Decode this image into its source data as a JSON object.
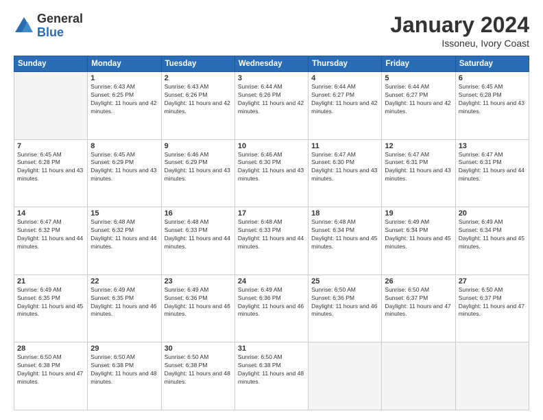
{
  "logo": {
    "general": "General",
    "blue": "Blue"
  },
  "header": {
    "month": "January 2024",
    "location": "Issoneu, Ivory Coast"
  },
  "weekdays": [
    "Sunday",
    "Monday",
    "Tuesday",
    "Wednesday",
    "Thursday",
    "Friday",
    "Saturday"
  ],
  "weeks": [
    [
      {
        "day": "",
        "sunrise": "",
        "sunset": "",
        "daylight": "",
        "empty": true
      },
      {
        "day": "1",
        "sunrise": "Sunrise: 6:43 AM",
        "sunset": "Sunset: 6:25 PM",
        "daylight": "Daylight: 11 hours and 42 minutes."
      },
      {
        "day": "2",
        "sunrise": "Sunrise: 6:43 AM",
        "sunset": "Sunset: 6:26 PM",
        "daylight": "Daylight: 11 hours and 42 minutes."
      },
      {
        "day": "3",
        "sunrise": "Sunrise: 6:44 AM",
        "sunset": "Sunset: 6:26 PM",
        "daylight": "Daylight: 11 hours and 42 minutes."
      },
      {
        "day": "4",
        "sunrise": "Sunrise: 6:44 AM",
        "sunset": "Sunset: 6:27 PM",
        "daylight": "Daylight: 11 hours and 42 minutes."
      },
      {
        "day": "5",
        "sunrise": "Sunrise: 6:44 AM",
        "sunset": "Sunset: 6:27 PM",
        "daylight": "Daylight: 11 hours and 42 minutes."
      },
      {
        "day": "6",
        "sunrise": "Sunrise: 6:45 AM",
        "sunset": "Sunset: 6:28 PM",
        "daylight": "Daylight: 11 hours and 43 minutes."
      }
    ],
    [
      {
        "day": "7",
        "sunrise": "Sunrise: 6:45 AM",
        "sunset": "Sunset: 6:28 PM",
        "daylight": "Daylight: 11 hours and 43 minutes."
      },
      {
        "day": "8",
        "sunrise": "Sunrise: 6:45 AM",
        "sunset": "Sunset: 6:29 PM",
        "daylight": "Daylight: 11 hours and 43 minutes."
      },
      {
        "day": "9",
        "sunrise": "Sunrise: 6:46 AM",
        "sunset": "Sunset: 6:29 PM",
        "daylight": "Daylight: 11 hours and 43 minutes."
      },
      {
        "day": "10",
        "sunrise": "Sunrise: 6:46 AM",
        "sunset": "Sunset: 6:30 PM",
        "daylight": "Daylight: 11 hours and 43 minutes."
      },
      {
        "day": "11",
        "sunrise": "Sunrise: 6:47 AM",
        "sunset": "Sunset: 6:30 PM",
        "daylight": "Daylight: 11 hours and 43 minutes."
      },
      {
        "day": "12",
        "sunrise": "Sunrise: 6:47 AM",
        "sunset": "Sunset: 6:31 PM",
        "daylight": "Daylight: 11 hours and 43 minutes."
      },
      {
        "day": "13",
        "sunrise": "Sunrise: 6:47 AM",
        "sunset": "Sunset: 6:31 PM",
        "daylight": "Daylight: 11 hours and 44 minutes."
      }
    ],
    [
      {
        "day": "14",
        "sunrise": "Sunrise: 6:47 AM",
        "sunset": "Sunset: 6:32 PM",
        "daylight": "Daylight: 11 hours and 44 minutes."
      },
      {
        "day": "15",
        "sunrise": "Sunrise: 6:48 AM",
        "sunset": "Sunset: 6:32 PM",
        "daylight": "Daylight: 11 hours and 44 minutes."
      },
      {
        "day": "16",
        "sunrise": "Sunrise: 6:48 AM",
        "sunset": "Sunset: 6:33 PM",
        "daylight": "Daylight: 11 hours and 44 minutes."
      },
      {
        "day": "17",
        "sunrise": "Sunrise: 6:48 AM",
        "sunset": "Sunset: 6:33 PM",
        "daylight": "Daylight: 11 hours and 44 minutes."
      },
      {
        "day": "18",
        "sunrise": "Sunrise: 6:48 AM",
        "sunset": "Sunset: 6:34 PM",
        "daylight": "Daylight: 11 hours and 45 minutes."
      },
      {
        "day": "19",
        "sunrise": "Sunrise: 6:49 AM",
        "sunset": "Sunset: 6:34 PM",
        "daylight": "Daylight: 11 hours and 45 minutes."
      },
      {
        "day": "20",
        "sunrise": "Sunrise: 6:49 AM",
        "sunset": "Sunset: 6:34 PM",
        "daylight": "Daylight: 11 hours and 45 minutes."
      }
    ],
    [
      {
        "day": "21",
        "sunrise": "Sunrise: 6:49 AM",
        "sunset": "Sunset: 6:35 PM",
        "daylight": "Daylight: 11 hours and 45 minutes."
      },
      {
        "day": "22",
        "sunrise": "Sunrise: 6:49 AM",
        "sunset": "Sunset: 6:35 PM",
        "daylight": "Daylight: 11 hours and 46 minutes."
      },
      {
        "day": "23",
        "sunrise": "Sunrise: 6:49 AM",
        "sunset": "Sunset: 6:36 PM",
        "daylight": "Daylight: 11 hours and 46 minutes."
      },
      {
        "day": "24",
        "sunrise": "Sunrise: 6:49 AM",
        "sunset": "Sunset: 6:36 PM",
        "daylight": "Daylight: 11 hours and 46 minutes."
      },
      {
        "day": "25",
        "sunrise": "Sunrise: 6:50 AM",
        "sunset": "Sunset: 6:36 PM",
        "daylight": "Daylight: 11 hours and 46 minutes."
      },
      {
        "day": "26",
        "sunrise": "Sunrise: 6:50 AM",
        "sunset": "Sunset: 6:37 PM",
        "daylight": "Daylight: 11 hours and 47 minutes."
      },
      {
        "day": "27",
        "sunrise": "Sunrise: 6:50 AM",
        "sunset": "Sunset: 6:37 PM",
        "daylight": "Daylight: 11 hours and 47 minutes."
      }
    ],
    [
      {
        "day": "28",
        "sunrise": "Sunrise: 6:50 AM",
        "sunset": "Sunset: 6:38 PM",
        "daylight": "Daylight: 11 hours and 47 minutes."
      },
      {
        "day": "29",
        "sunrise": "Sunrise: 6:50 AM",
        "sunset": "Sunset: 6:38 PM",
        "daylight": "Daylight: 11 hours and 48 minutes."
      },
      {
        "day": "30",
        "sunrise": "Sunrise: 6:50 AM",
        "sunset": "Sunset: 6:38 PM",
        "daylight": "Daylight: 11 hours and 48 minutes."
      },
      {
        "day": "31",
        "sunrise": "Sunrise: 6:50 AM",
        "sunset": "Sunset: 6:38 PM",
        "daylight": "Daylight: 11 hours and 48 minutes."
      },
      {
        "day": "",
        "sunrise": "",
        "sunset": "",
        "daylight": "",
        "empty": true
      },
      {
        "day": "",
        "sunrise": "",
        "sunset": "",
        "daylight": "",
        "empty": true
      },
      {
        "day": "",
        "sunrise": "",
        "sunset": "",
        "daylight": "",
        "empty": true
      }
    ]
  ]
}
